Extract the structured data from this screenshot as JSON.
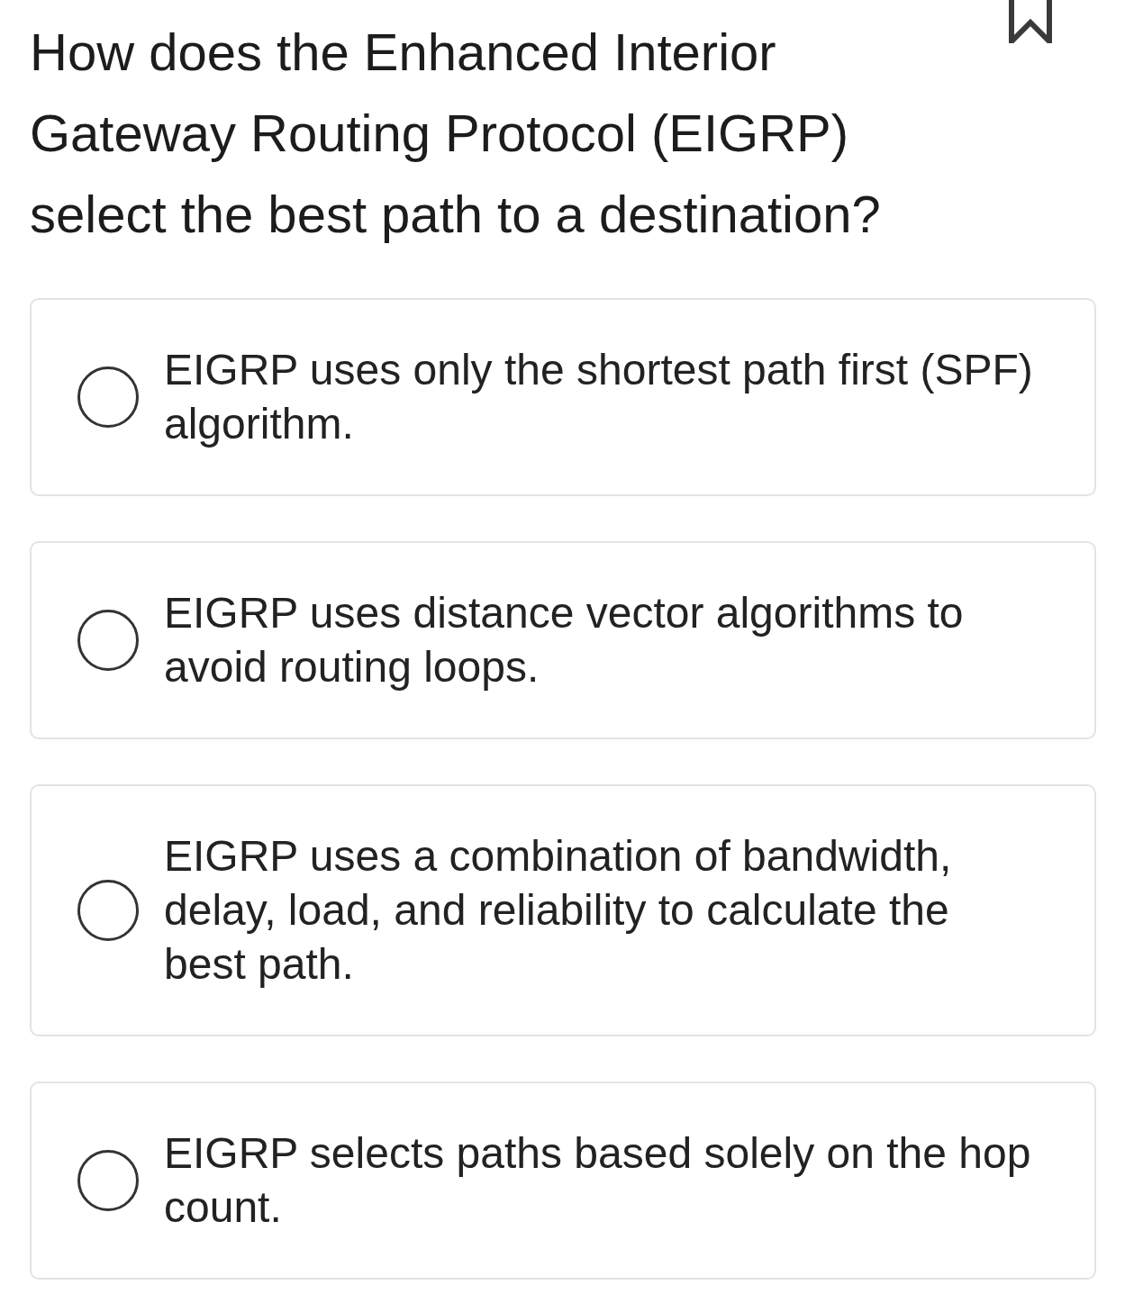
{
  "question": {
    "text": "How does the Enhanced Interior Gateway Routing Protocol (EIGRP) select the best path to a destination?",
    "bookmarked": false
  },
  "options": [
    {
      "text": "EIGRP uses only the shortest path first (SPF) algorithm.",
      "selected": false
    },
    {
      "text": "EIGRP uses distance vector algorithms to avoid routing loops.",
      "selected": false
    },
    {
      "text": "EIGRP uses a combination of bandwidth, delay, load, and reliability to calculate the best path.",
      "selected": false
    },
    {
      "text": "EIGRP selects paths based solely on the hop count.",
      "selected": false
    }
  ]
}
